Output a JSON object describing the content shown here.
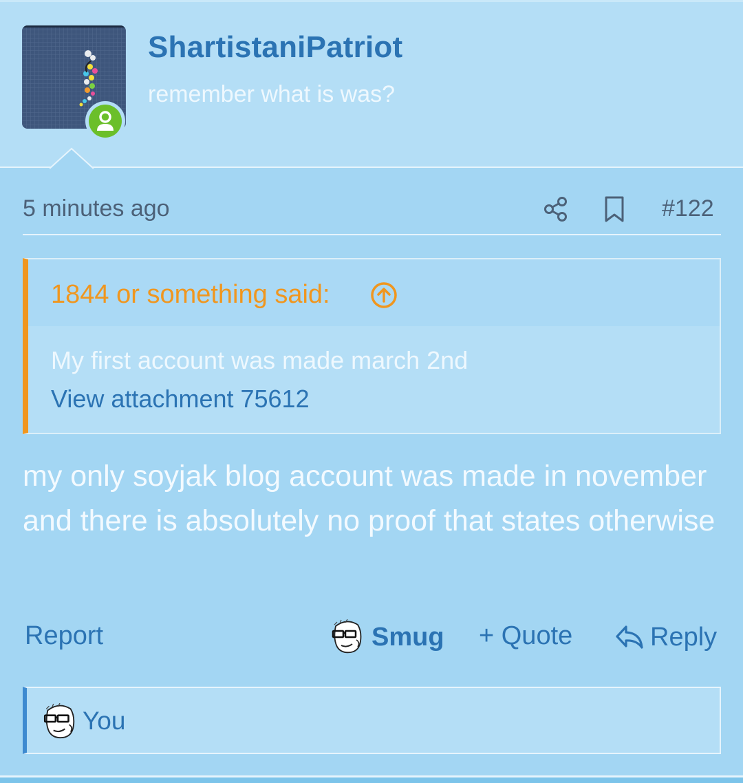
{
  "user": {
    "name": "ShartistaniPatriot",
    "title": "remember what is was?"
  },
  "post": {
    "time": "5 minutes ago",
    "number": "#122",
    "body": "my only soyjak blog account was made in november and there is absolutely no proof that states otherwise"
  },
  "quote": {
    "author": "1844 or something said:",
    "text": "My first account was made march 2nd",
    "attachment": "View attachment 75612"
  },
  "actions": {
    "report": "Report",
    "reaction": "Smug",
    "quote": "+ Quote",
    "reply": "Reply"
  },
  "reactions": {
    "user": "You"
  },
  "icons": {
    "share": "share-icon",
    "bookmark": "bookmark-icon",
    "quote_jump": "arrow-up-circle-icon",
    "reply": "reply-arrow-icon",
    "status": "user-icon"
  },
  "colors": {
    "link": "#2b73b3",
    "quote_accent": "#f0961e",
    "status_online": "#6bbf2a",
    "background": "#a3d6f3"
  }
}
